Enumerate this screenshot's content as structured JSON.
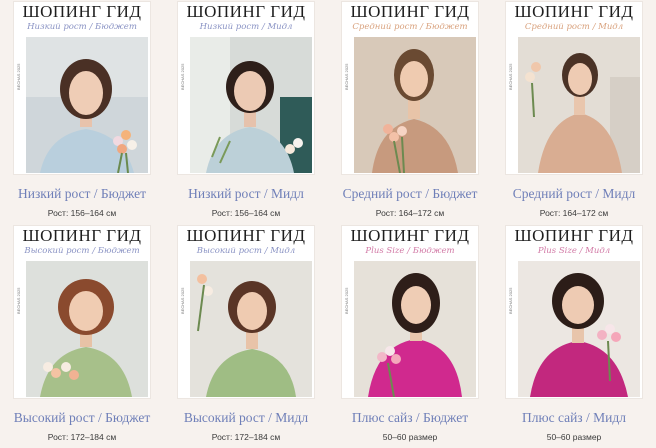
{
  "colors": {
    "page_background": "#f7f2ee",
    "caption": "#6f7fb8",
    "sub_blue": "#8a93c4",
    "sub_peach": "#d9a27e",
    "sub_pink": "#d27aa6"
  },
  "cards": [
    {
      "cover_title": "ШОПИНГ ГИД",
      "cover_sub": "Низкий рост / Бюджет",
      "cover_side": "BECHAS 2025",
      "caption": "Низкий рост / Бюджет",
      "size": "Рост: 156–164 см"
    },
    {
      "cover_title": "ШОПИНГ ГИД",
      "cover_sub": "Низкий рост / Мидл",
      "cover_side": "BECHAS 2025",
      "caption": "Низкий рост / Мидл",
      "size": "Рост: 156–164 см"
    },
    {
      "cover_title": "ШОПИНГ ГИД",
      "cover_sub": "Средний рост / Бюджет",
      "cover_side": "BECHAS 2025",
      "caption": "Средний рост / Бюджет",
      "size": "Рост: 164–172 см"
    },
    {
      "cover_title": "ШОПИНГ ГИД",
      "cover_sub": "Средний рост / Мидл",
      "cover_side": "BECHAS 2025",
      "caption": "Средний рост / Мидл",
      "size": "Рост: 164–172 см"
    },
    {
      "cover_title": "ШОПИНГ ГИД",
      "cover_sub": "Высокий рост / Бюджет",
      "cover_side": "BECHAS 2025",
      "caption": "Высокий рост / Бюджет",
      "size": "Рост: 172–184 см"
    },
    {
      "cover_title": "ШОПИНГ ГИД",
      "cover_sub": "Высокий рост / Мидл",
      "cover_side": "BECHAS 2025",
      "caption": "Высокий рост / Мидл",
      "size": "Рост: 172–184 см"
    },
    {
      "cover_title": "ШОПИНГ ГИД",
      "cover_sub": "Plus Size / Бюджет",
      "cover_side": "BECHAS 2025",
      "caption": "Плюс сайз / Бюджет",
      "size": "50–60 размер"
    },
    {
      "cover_title": "ШОПИНГ ГИД",
      "cover_sub": "Plus Size / Мидл",
      "cover_side": "BECHAS 2025",
      "caption": "Плюс сайз / Мидл",
      "size": "50–60 размер"
    }
  ]
}
